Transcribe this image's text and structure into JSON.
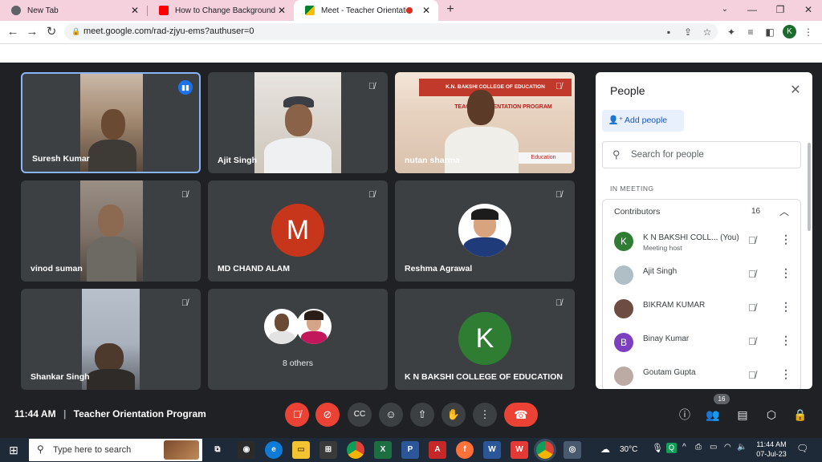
{
  "browser": {
    "tabs": [
      {
        "title": "New Tab"
      },
      {
        "title": "How to Change Background in G"
      },
      {
        "title": "Meet - Teacher Orientation P"
      }
    ],
    "url": "meet.google.com/rad-zjyu-ems?authuser=0",
    "profile_initial": "K"
  },
  "tiles": [
    {
      "name": "Suresh Kumar"
    },
    {
      "name": "Ajit Singh"
    },
    {
      "name": "nutan sharma",
      "banner_line1": "K.N. BAKSHI COLLEGE OF EDUCATION",
      "banner_line2": "TEACHER ORIENTATION PROGRAM",
      "banner_footer": "Education"
    },
    {
      "name": "vinod suman"
    },
    {
      "name": "MD CHAND ALAM",
      "initial": "M"
    },
    {
      "name": "Reshma Agrawal"
    },
    {
      "name": "Shankar Singh"
    },
    {
      "name": "8 others"
    },
    {
      "name": "K N BAKSHI COLLEGE OF EDUCATION",
      "initial": "K"
    }
  ],
  "people_panel": {
    "title": "People",
    "add_people": "Add people",
    "search_placeholder": "Search for people",
    "section_label": "IN MEETING",
    "group_label": "Contributors",
    "group_count": "16",
    "participants": [
      {
        "name": "K N BAKSHI COLL...",
        "you": "(You)",
        "subtitle": "Meeting host",
        "initial": "K",
        "color": "#2e7d32"
      },
      {
        "name": "Ajit Singh",
        "initial": "",
        "color": "#9e9e9e"
      },
      {
        "name": "BIKRAM KUMAR",
        "initial": "",
        "color": "#6d4c41"
      },
      {
        "name": "Binay Kumar",
        "initial": "B",
        "color": "#7b3fbf"
      },
      {
        "name": "Goutam Gupta",
        "initial": "",
        "color": "#a1887f"
      }
    ]
  },
  "meeting_bar": {
    "time": "11:44 AM",
    "separator": "|",
    "meeting_name": "Teacher Orientation Program",
    "participant_badge": "16"
  },
  "taskbar": {
    "search_placeholder": "Type here to search",
    "weather": "30°C",
    "clock_time": "11:44 AM",
    "clock_date": "07-Jul-23"
  }
}
